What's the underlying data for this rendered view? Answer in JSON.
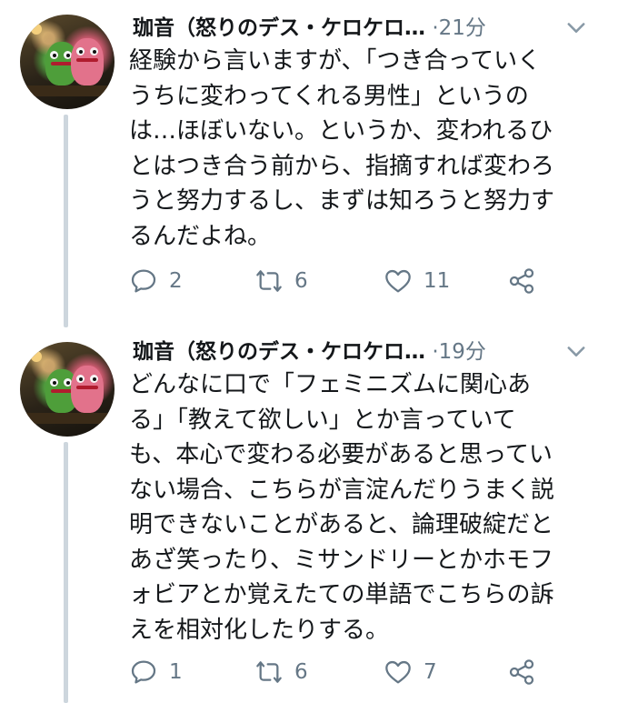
{
  "colors": {
    "text": "#14171a",
    "secondary": "#657786",
    "thread_line": "#cdd6dd",
    "background": "#ffffff"
  },
  "tweets": [
    {
      "display_name": "珈音（怒りのデス・ケロケロ…",
      "separator": "·",
      "time": "21分",
      "text": "経験から言いますが、「つき合っていく\nうちに変わってくれる男性」というの\nは…ほぼいない。というか、変われるひ\nとはつき合う前から、指摘すれば変わろ\nうと努力するし、まずは知ろうと努力す\nるんだよね。",
      "reply_count": "2",
      "retweet_count": "6",
      "like_count": "11",
      "icons": [
        "reply-icon",
        "retweet-icon",
        "like-icon",
        "share-icon",
        "chevron-down-icon"
      ]
    },
    {
      "display_name": "珈音（怒りのデス・ケロケロ…",
      "separator": "·",
      "time": "19分",
      "text": "どんなに口で「フェミニズムに関心あ\nる」「教えて欲しい」とか言っていて\nも、本心で変わる必要があると思ってい\nない場合、こちらが言淀んだりうまく説\n明できないことがあると、論理破綻だと\nあざ笑ったり、ミサンドリーとかホモフ\nォビアとか覚えたての単語でこちらの訴\nえを相対化したりする。",
      "reply_count": "1",
      "retweet_count": "6",
      "like_count": "7",
      "icons": [
        "reply-icon",
        "retweet-icon",
        "like-icon",
        "share-icon",
        "chevron-down-icon"
      ]
    }
  ]
}
